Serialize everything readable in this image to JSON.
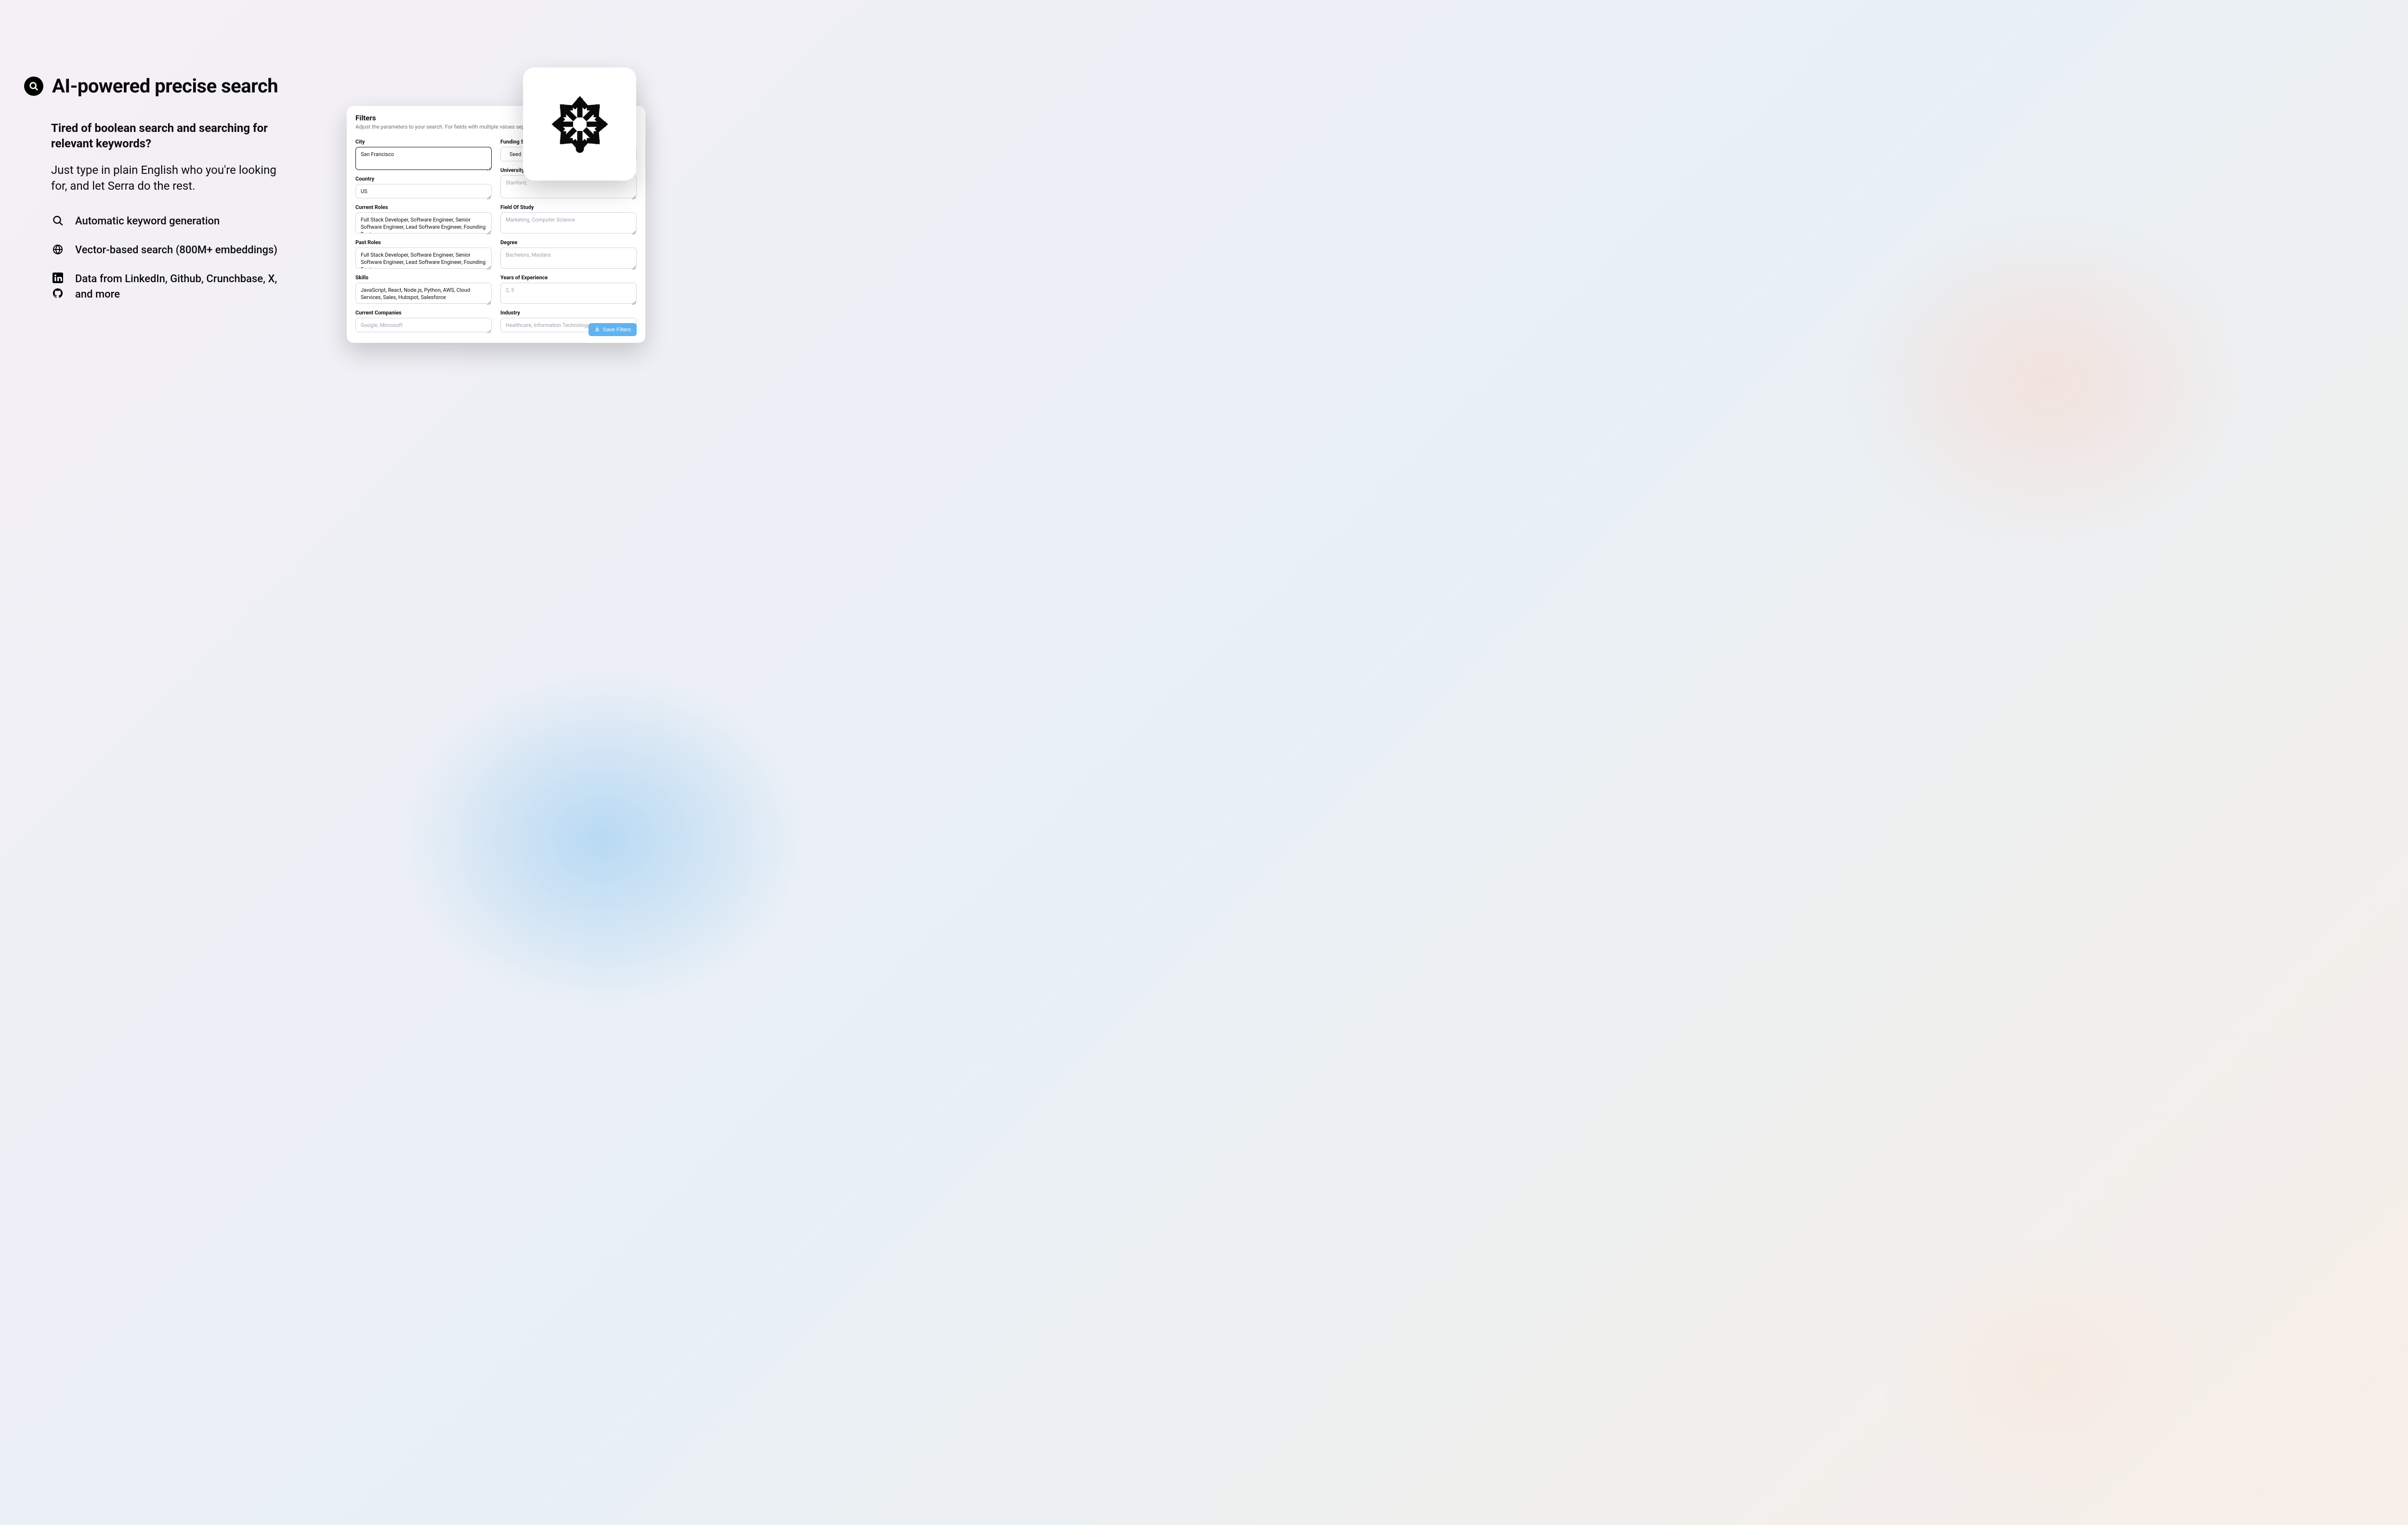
{
  "hero": {
    "title": "AI-powered precise search"
  },
  "subhead": "Tired of boolean search and searching for relevant keywords?",
  "subtext": "Just type in plain English who you're looking for, and let Serra do the rest.",
  "bullets": {
    "b1": "Automatic keyword generation",
    "b2": "Vector-based search (800M+ embeddings)",
    "b3": "Data from LinkedIn, Github, Crunchbase, X, and more"
  },
  "filters": {
    "title": "Filters",
    "desc": "Adjust the parameters to your search. For fields with multiple values separate terms w",
    "labels": {
      "city": "City",
      "country": "Country",
      "current_roles": "Current Roles",
      "past_roles": "Past Roles",
      "skills": "Skills",
      "current_companies": "Current Companies",
      "funding_stage": "Funding Sta",
      "university": "University",
      "field_of_study": "Field Of Study",
      "degree": "Degree",
      "years_exp": "Years of Experience",
      "industry": "Industry"
    },
    "values": {
      "city": "San Francisco",
      "country": "US",
      "current_roles": "Full Stack Developer, Software Engineer, Senior Software Engineer, Lead Software Engineer, Founding Engineer",
      "past_roles": "Full Stack Developer, Software Engineer, Senior Software Engineer, Lead Software Engineer, Founding Engineer",
      "skills": "JavaScript, React, Node.js, Python, AWS, Cloud Services, Sales, Hubspot, Salesforce",
      "funding_stage": "Seed"
    },
    "placeholders": {
      "university": "Stanford,",
      "field_of_study": "Marketing, Computer Science",
      "degree": "Bachelors, Masters",
      "years_exp": "2, 5",
      "industry": "Healthcare, Information Technology",
      "current_companies": "Google, Microsoft"
    },
    "save_button": "Save Filters"
  }
}
